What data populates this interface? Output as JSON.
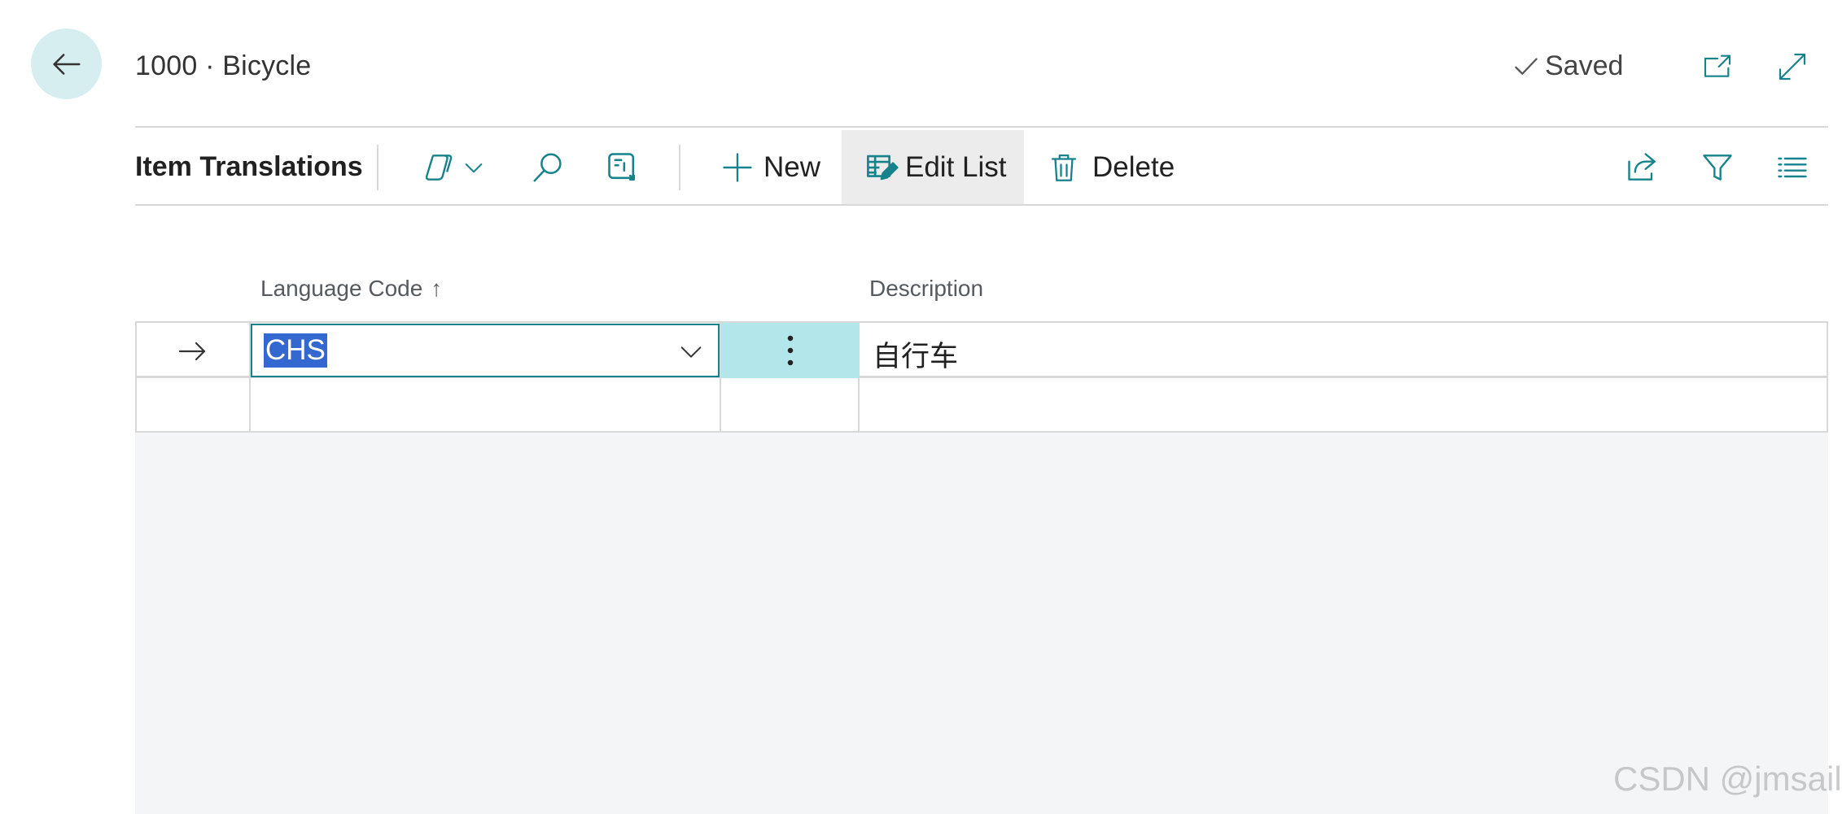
{
  "header": {
    "record_title": "1000 · Bicycle",
    "saved_label": "Saved"
  },
  "actionbar": {
    "title": "Item Translations",
    "new_label": "New",
    "edit_list_label": "Edit List",
    "delete_label": "Delete"
  },
  "grid": {
    "columns": [
      {
        "label": "Language Code",
        "sort": "↑"
      },
      {
        "label": "Description"
      }
    ],
    "rows": [
      {
        "language_code": "CHS",
        "description": "自行车",
        "current": true
      },
      {
        "language_code": "",
        "description": "",
        "current": false
      }
    ]
  },
  "watermark": "CSDN @jmsail",
  "icons": [
    "back-arrow-icon",
    "checkmark-icon",
    "open-new-window-icon",
    "expand-icon",
    "copilot-icon",
    "chevron-down-icon",
    "search-icon",
    "personalize-icon",
    "plus-icon",
    "edit-list-icon",
    "trash-icon",
    "share-icon",
    "filter-icon",
    "list-view-icon",
    "row-pointer-arrow-icon",
    "more-options-icon"
  ],
  "colors": {
    "accent": "#16828c",
    "back_button_bg": "#d7eef0",
    "selection": "#3468d1",
    "menu_cell_bg": "#b3e6ea",
    "grid_bg": "#f4f5f7"
  }
}
